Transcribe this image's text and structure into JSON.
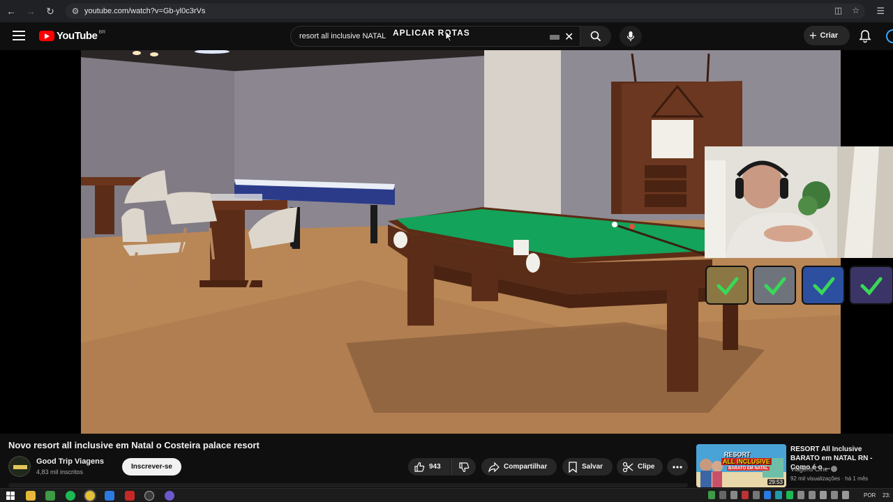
{
  "browser": {
    "url": "youtube.com/watch?v=Gb-yl0c3rVs"
  },
  "header": {
    "logo_text": "YouTube",
    "region": "BR",
    "search_value": "resort all inclusive NATAL",
    "create_label": "Criar"
  },
  "overlay": {
    "text": "APLICAR ROTAS"
  },
  "video": {
    "title": "Novo resort all inclusive em Natal o Costeira palace resort",
    "channel_name": "Good Trip Viagens",
    "subscribers": "4,83 mil inscritos",
    "subscribe_label": "Inscrever-se",
    "likes": "943",
    "share_label": "Compartilhar",
    "save_label": "Salvar",
    "clip_label": "Clipe"
  },
  "recommendation": {
    "title": "RESORT All Inclusive BARATO em NATAL RN - Como é o ...",
    "channel": "Viagens Cine",
    "meta": "92 mil visualizações · há 1 mês",
    "duration": "29:53",
    "thumb_line1": "RESORT",
    "thumb_line2": "ALL INCLUSIVE",
    "thumb_line3": "BARATO EM NATAL"
  },
  "taskbar": {
    "language": "POR",
    "time": "23:"
  },
  "colors": {
    "brand_red": "#ff0000",
    "felt_green": "#13a35a",
    "wood": "#5a2d18",
    "floor": "#b88455",
    "wall": "#8c8690"
  }
}
